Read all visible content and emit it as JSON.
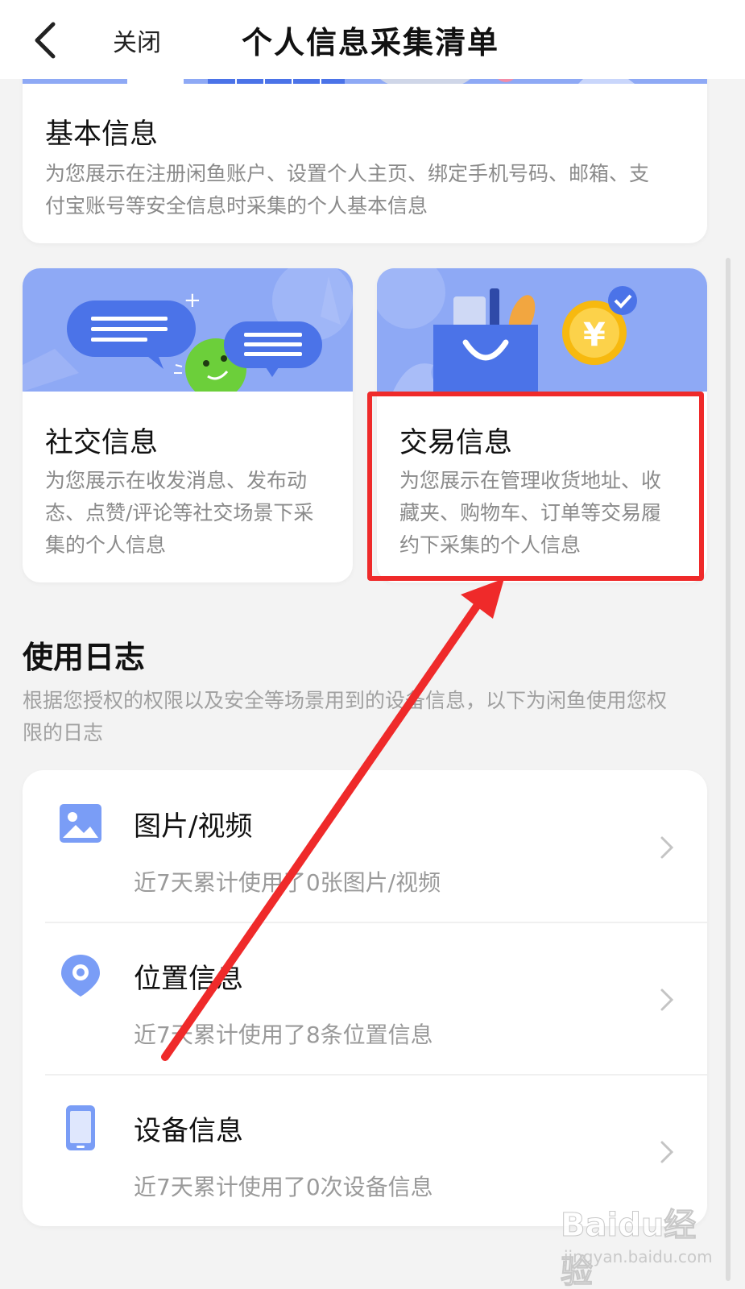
{
  "nav": {
    "close_label": "关闭",
    "title": "个人信息采集清单"
  },
  "cards": {
    "basic": {
      "title": "基本信息",
      "desc_line1": "为您展示在注册闲鱼账户、设置个人主页、绑定手机号码、邮箱、支",
      "desc_line2": "付宝账号等安全信息时采集的个人基本信息"
    },
    "social": {
      "title": "社交信息",
      "desc_line1": "为您展示在收发消息、发布动",
      "desc_line2": "态、点赞/评论等社交场景下采",
      "desc_line3": "集的个人信息"
    },
    "trade": {
      "title": "交易信息",
      "desc_line1": "为您展示在管理收货地址、收",
      "desc_line2": "藏夹、购物车、订单等交易履",
      "desc_line3": "约下采集的个人信息",
      "coin_symbol": "¥"
    }
  },
  "usage_log": {
    "title": "使用日志",
    "desc_line1": "根据您授权的权限以及安全等场景用到的设备信息，以下为闲鱼使用您权",
    "desc_line2": "限的日志",
    "rows": [
      {
        "title": "图片/视频",
        "sub": "近7天累计使用了0张图片/视频",
        "icon": "image-icon"
      },
      {
        "title": "位置信息",
        "sub": "近7天累计使用了8条位置信息",
        "icon": "location-pin-icon"
      },
      {
        "title": "设备信息",
        "sub": "近7天累计使用了0次设备信息",
        "icon": "phone-icon"
      }
    ]
  },
  "watermark": {
    "brand": "Baidu经验",
    "url": "jingyan.baidu.com"
  },
  "colors": {
    "accent_blue": "#5b84f0",
    "banner_blue": "#8ea9f5",
    "annotation_red": "#ef2a2a",
    "coin_yellow": "#f7b90f",
    "face_green": "#6ccf3a"
  }
}
